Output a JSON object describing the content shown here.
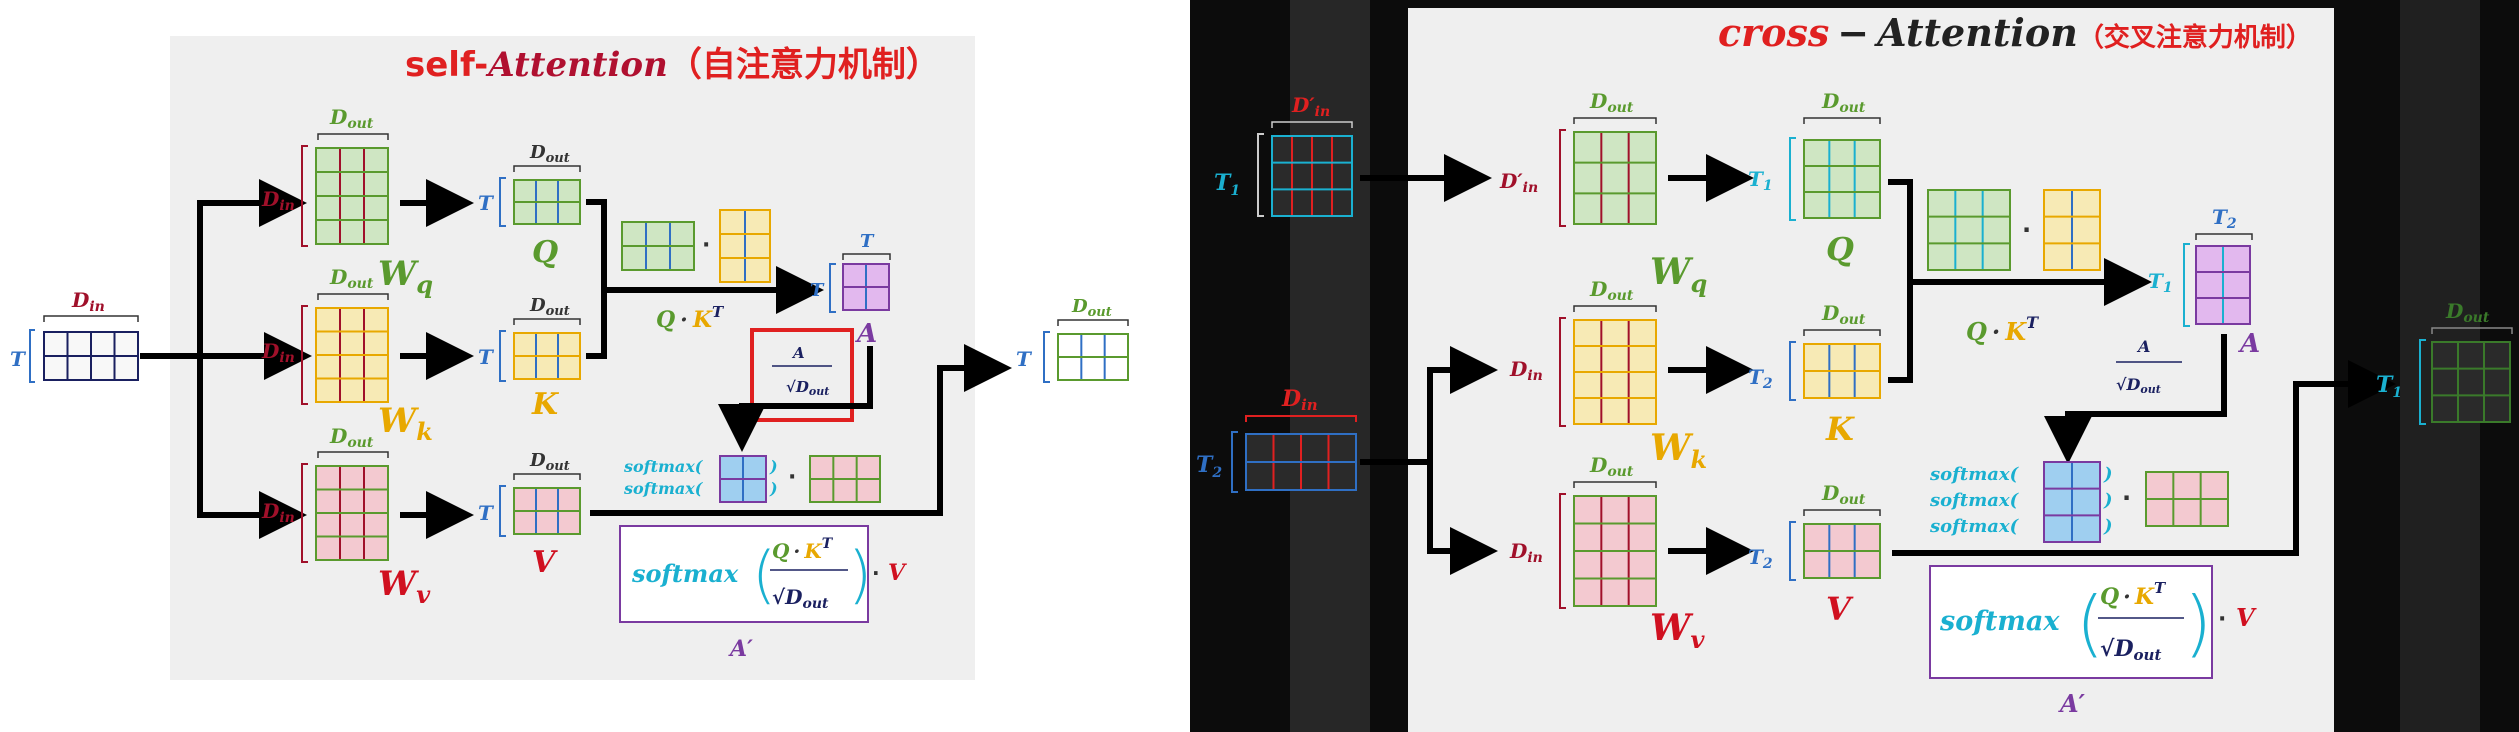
{
  "left_panel": {
    "title_prefix": "self-",
    "title_main": "Attention",
    "title_cn": "（自注意力机制）",
    "dim_in": "D",
    "dim_in_sub": "in",
    "dim_out": "D",
    "dim_out_sub": "out",
    "T": "T",
    "W": "W",
    "wq_sub": "q",
    "wk_sub": "k",
    "wv_sub": "v",
    "Q": "Q",
    "K": "K",
    "V": "V",
    "A": "A",
    "qkt_Q": "Q",
    "dot": "·",
    "qkt_K": "K",
    "sup_T": "T",
    "softmax": "softmax(",
    "paren_close": ")",
    "formula_softmax": "softmax",
    "formula_V": "V",
    "A_prime": "A′"
  },
  "right_panel": {
    "title_main": "cross",
    "title_dash": "−",
    "title_attention": "Attention",
    "title_cn": "（交叉注意力机制）",
    "T1": "T",
    "T1_sub": "1",
    "T2": "T",
    "T2_sub": "2",
    "d_prime_in": "D′",
    "in_sub": "in",
    "dim_in": "D",
    "dim_out": "D",
    "out_sub": "out",
    "W": "W",
    "wq_sub": "q",
    "wk_sub": "k",
    "wv_sub": "v",
    "Q": "Q",
    "K": "K",
    "V": "V",
    "A": "A",
    "qkt_Q": "Q",
    "dot": "·",
    "qkt_K": "K",
    "sup_T": "T",
    "softmax": "softmax(",
    "paren_close": ")",
    "formula_softmax": "softmax",
    "formula_V": "V",
    "A_prime": "A′"
  },
  "colors": {
    "red": "#e02020",
    "darkred": "#a0102a",
    "green": "#5a9a2e",
    "gold": "#e8a800",
    "blue": "#2f6fc4",
    "cyan": "#1ab0d0",
    "purple": "#7a3aa0",
    "pink": "#f2b8bf",
    "lgreen": "#cfe6c3",
    "lyellow": "#f7eab5",
    "lblue": "#cfe2f5",
    "lpink": "#f3c9d0",
    "violet": "#e2b8ee"
  }
}
